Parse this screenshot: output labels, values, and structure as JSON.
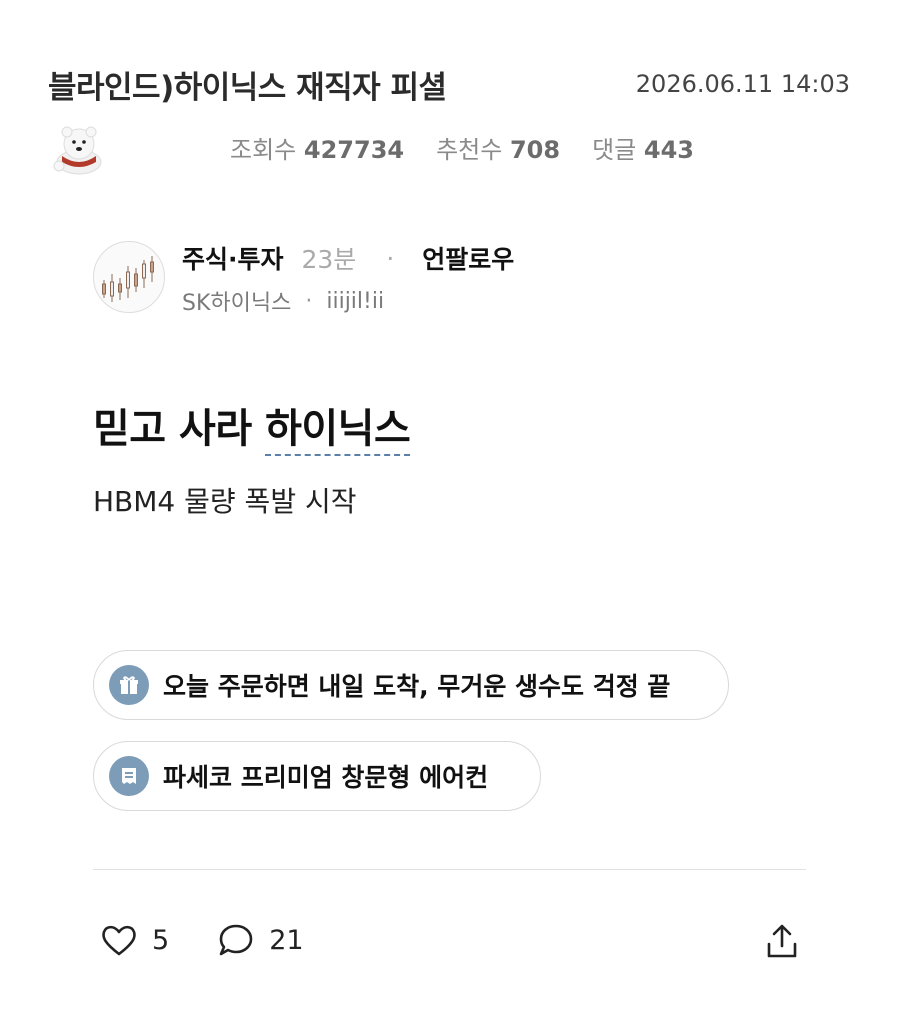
{
  "post": {
    "title": "블라인드)하이닉스 재직자 피셜",
    "date": "2026.06.11 14:03",
    "stats": {
      "views_label": "조회수",
      "views": "427734",
      "likes_label": "추천수",
      "likes": "708",
      "comments_label": "댓글",
      "comments": "443"
    }
  },
  "author": {
    "category": "주식·투자",
    "time": "23분",
    "follow": "언팔로우",
    "company": "SK하이닉스",
    "nickname": "iiijil!ii"
  },
  "content": {
    "headline_pre": "믿고 사라 ",
    "headline_keyword": "하이닉스",
    "body": "HBM4 물량 폭발 시작"
  },
  "chips": [
    {
      "label": "오늘 주문하면 내일 도착, 무거운 생수도 걱정 끝",
      "icon": "gift-icon"
    },
    {
      "label": "파세코 프리미엄 창문형 에어컨",
      "icon": "receipt-icon"
    }
  ],
  "actions": {
    "likes": "5",
    "comments": "21"
  },
  "colors": {
    "accent": "#7d9cb8",
    "keyword_underline": "#5a7fa8"
  }
}
